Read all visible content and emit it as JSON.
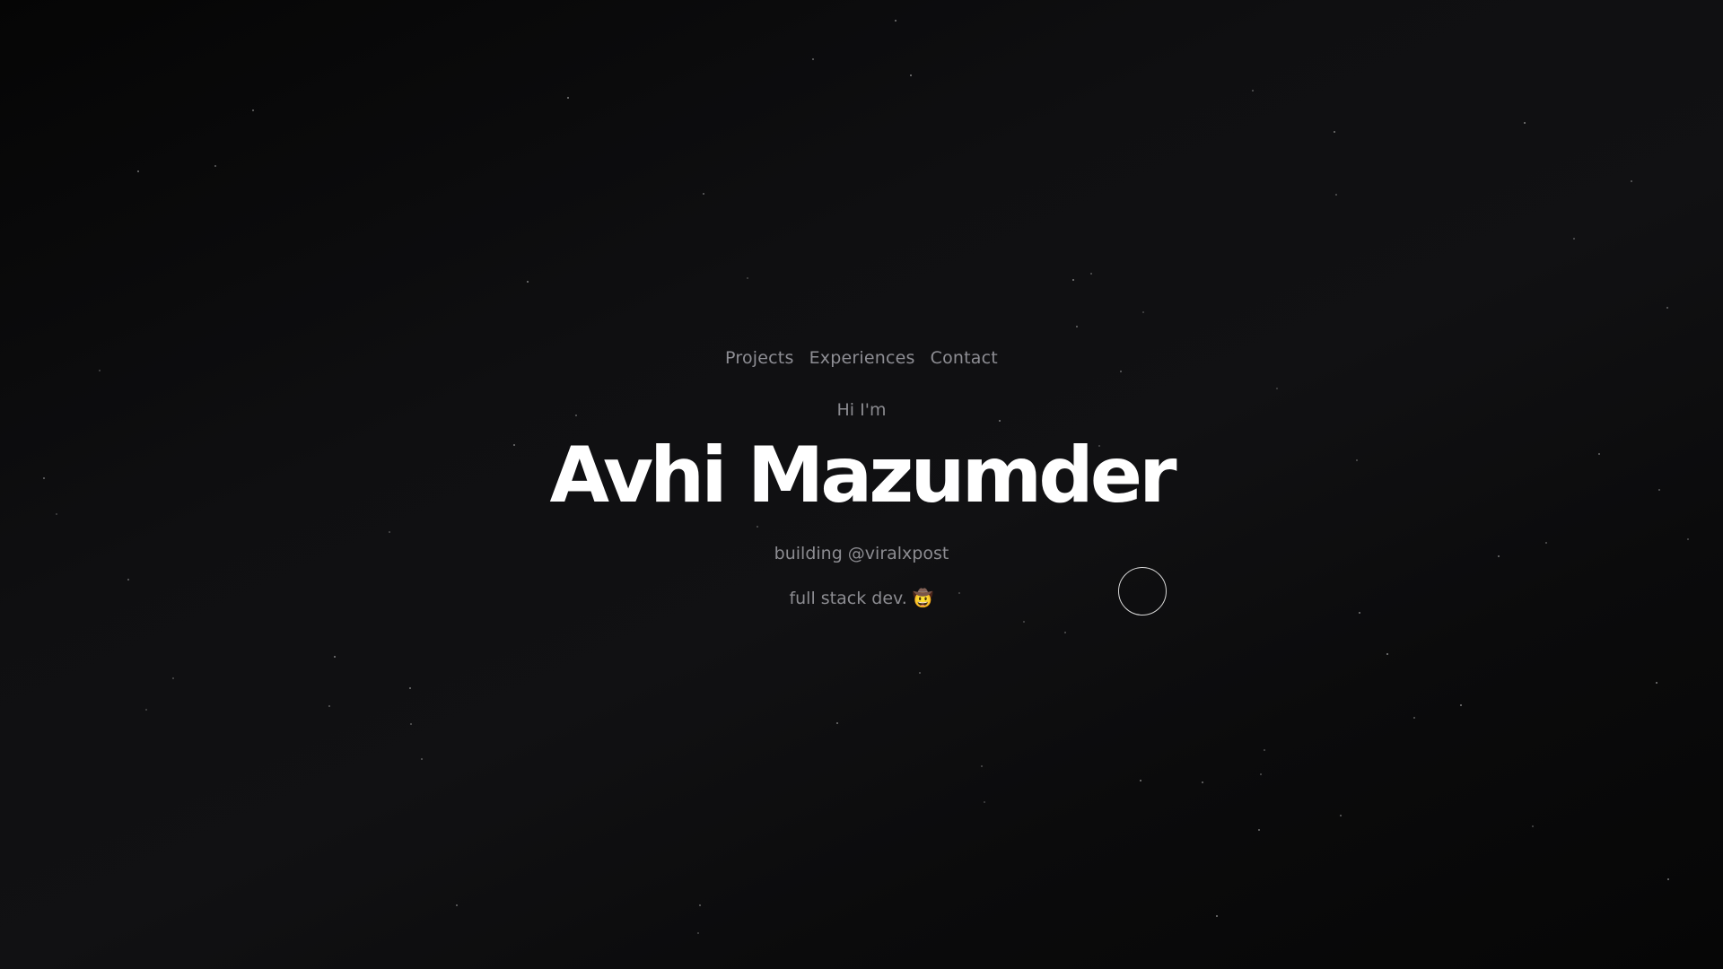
{
  "nav": {
    "items": [
      {
        "label": "Projects"
      },
      {
        "label": "Experiences"
      },
      {
        "label": "Contact"
      }
    ]
  },
  "hero": {
    "greeting": "Hi I'm",
    "name": "Avhi Mazumder",
    "tagline": "building @viralxpost",
    "role": "full stack dev. 🤠"
  },
  "colors": {
    "background": "#0e0e10",
    "heading": "#ffffff",
    "muted_text": "#8c8c91",
    "star": "#8a8a8a"
  },
  "icons": {
    "cursor": "cursor-ring-icon"
  }
}
